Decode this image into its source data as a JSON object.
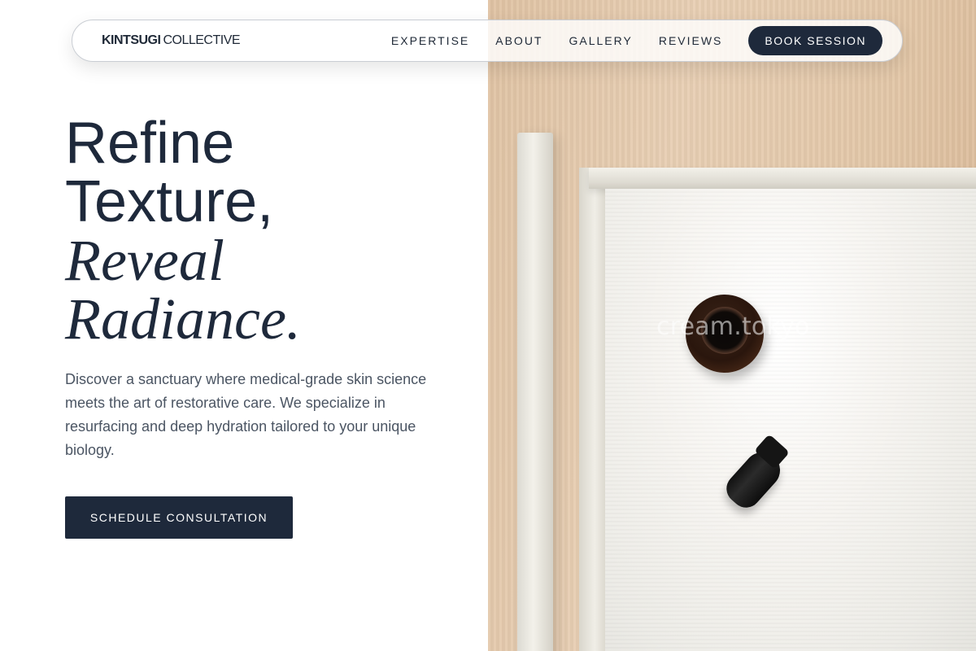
{
  "brand": {
    "name_strong": "KINTSUGI",
    "name_light": "COLLECTIVE"
  },
  "nav": {
    "links": [
      "EXPERTISE",
      "ABOUT",
      "GALLERY",
      "REVIEWS"
    ],
    "cta_label": "BOOK SESSION"
  },
  "hero": {
    "title_line1": "Refine",
    "title_line2": "Texture,",
    "title_line3": "Reveal",
    "title_line4": "Radiance.",
    "description": "Discover a sanctuary where medical-grade skin science meets the art of restorative care. We specialize in resurfacing and deep hydration tailored to your unique biology.",
    "cta_label": "SCHEDULE CONSULTATION"
  },
  "image": {
    "watermark": "cream.tokyo"
  },
  "colors": {
    "primary": "#1e293b",
    "body_text": "#4b5563",
    "photo_wood": "#e3c7a8"
  }
}
